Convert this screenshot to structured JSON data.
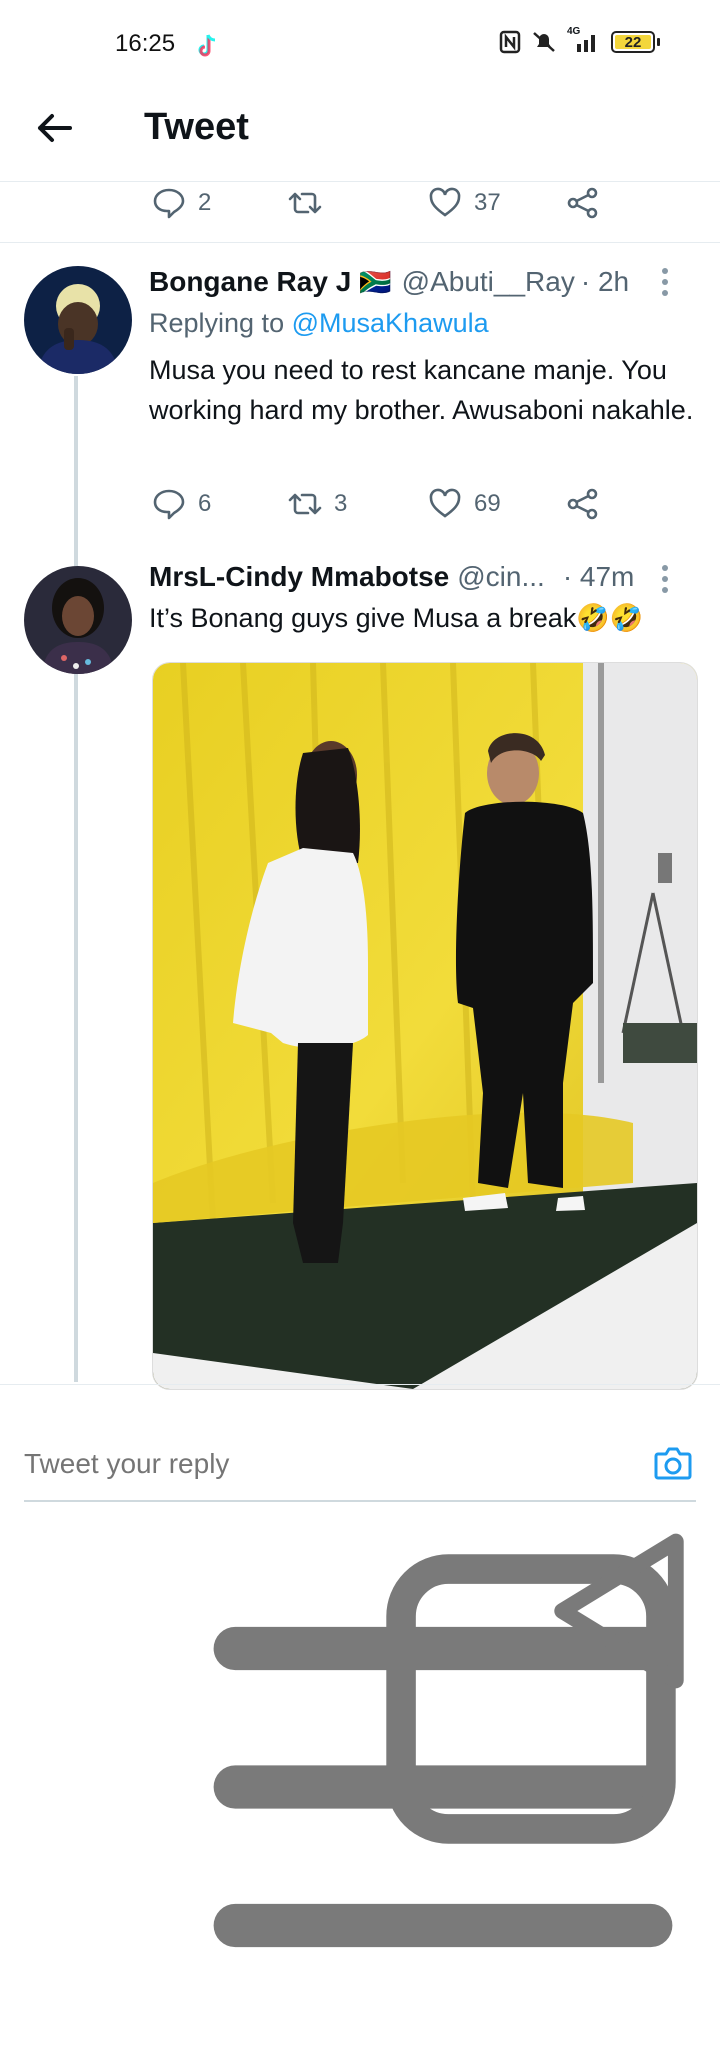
{
  "status_bar": {
    "time": "16:25",
    "network": "4G",
    "battery": "22"
  },
  "header": {
    "title": "Tweet"
  },
  "top_actions": {
    "replies": "2",
    "likes": "37"
  },
  "tweets": [
    {
      "name": "Bongane Ray J",
      "flag": "🇿🇦",
      "handle": "@Abuti__Ray",
      "time": "· 2h",
      "replying_prefix": "Replying to",
      "replying_handle": "@MusaKhawula",
      "text": "Musa you need to rest kancane manje. You working hard my brother. Awusaboni nakahle.",
      "replies": "6",
      "retweets": "3",
      "likes": "69"
    },
    {
      "name": "MrsL-Cindy Mmabotse",
      "handle": "@cin...",
      "time": "· 47m",
      "text": "It’s Bonang guys give Musa a break🤣🤣"
    }
  ],
  "reply_box": {
    "placeholder": "Tweet your reply"
  },
  "colors": {
    "accent": "#1d9bf0",
    "muted": "#536471",
    "thread_line": "#cfd9de"
  }
}
